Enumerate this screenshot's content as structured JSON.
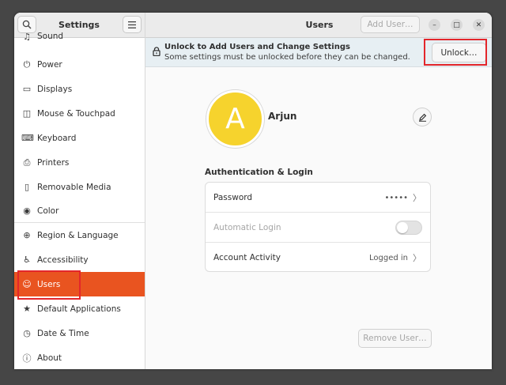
{
  "sidebar": {
    "title": "Settings",
    "search_icon": "search-icon",
    "menu_icon": "hamburger-menu-icon",
    "items": [
      {
        "label": "Sound",
        "icon": "music-note-icon",
        "glyph": "♫"
      },
      {
        "label": "Power",
        "icon": "power-icon",
        "glyph": "⏻"
      },
      {
        "label": "Displays",
        "icon": "display-icon",
        "glyph": "▭"
      },
      {
        "label": "Mouse & Touchpad",
        "icon": "mouse-icon",
        "glyph": "◫"
      },
      {
        "label": "Keyboard",
        "icon": "keyboard-icon",
        "glyph": "⌨"
      },
      {
        "label": "Printers",
        "icon": "printer-icon",
        "glyph": "⎙"
      },
      {
        "label": "Removable Media",
        "icon": "removable-media-icon",
        "glyph": "▯"
      },
      {
        "label": "Color",
        "icon": "color-icon",
        "glyph": "◉"
      },
      {
        "label": "Region & Language",
        "icon": "globe-icon",
        "glyph": "⊕"
      },
      {
        "label": "Accessibility",
        "icon": "accessibility-icon",
        "glyph": "♿"
      },
      {
        "label": "Users",
        "icon": "user-icon",
        "glyph": "☺"
      },
      {
        "label": "Default Applications",
        "icon": "star-icon",
        "glyph": "★"
      },
      {
        "label": "Date & Time",
        "icon": "clock-icon",
        "glyph": "◷"
      },
      {
        "label": "About",
        "icon": "info-icon",
        "glyph": "ⓘ"
      }
    ]
  },
  "header": {
    "title": "Users",
    "add_user_label": "Add User…",
    "minimize_glyph": "–",
    "maximize_glyph": "□",
    "close_glyph": "✕"
  },
  "infobar": {
    "title": "Unlock to Add Users and Change Settings",
    "subtitle": "Some settings must be unlocked before they can be changed.",
    "unlock_label": "Unlock…"
  },
  "user": {
    "avatar_letter": "A",
    "avatar_color": "#f6d32d",
    "name": "Arjun"
  },
  "auth": {
    "section_title": "Authentication & Login",
    "rows": [
      {
        "label": "Password",
        "value": "•••••"
      },
      {
        "label": "Automatic Login",
        "value": ""
      },
      {
        "label": "Account Activity",
        "value": "Logged in"
      }
    ]
  },
  "remove_user_label": "Remove User…",
  "colors": {
    "accent": "#e95420",
    "highlight": "#e3262b"
  }
}
